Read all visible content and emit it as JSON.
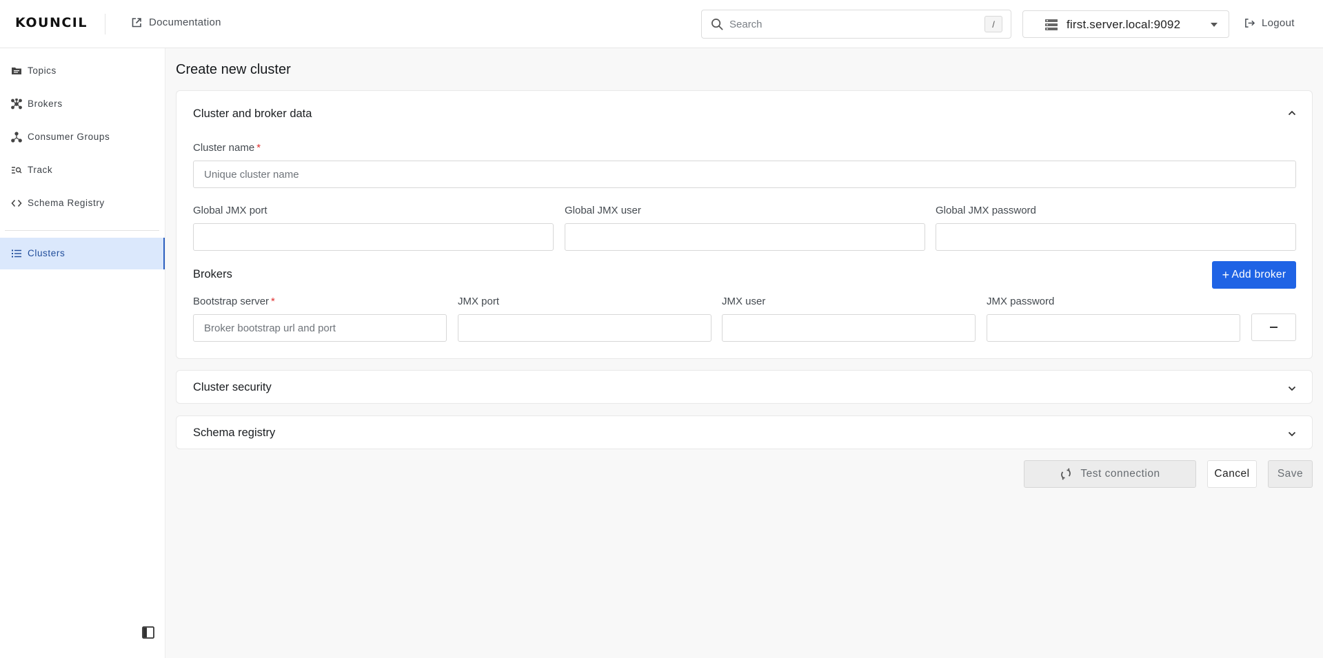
{
  "header": {
    "logo": "KOUNCIL",
    "documentation_label": "Documentation",
    "search_placeholder": "Search",
    "search_shortcut": "/",
    "server_selected": "first.server.local:9092",
    "logout_label": "Logout"
  },
  "sidebar": {
    "items": [
      {
        "label": "Topics",
        "icon": "folder-icon"
      },
      {
        "label": "Brokers",
        "icon": "brokers-network-icon"
      },
      {
        "label": "Consumer Groups",
        "icon": "consumer-groups-icon"
      },
      {
        "label": "Track",
        "icon": "track-search-icon"
      },
      {
        "label": "Schema Registry",
        "icon": "code-icon"
      },
      {
        "label": "Clusters",
        "icon": "list-icon",
        "active": true
      }
    ]
  },
  "main": {
    "page_title": "Create new cluster",
    "cluster_section": {
      "title": "Cluster and broker data",
      "cluster_name_label": "Cluster name",
      "required_mark": "*",
      "cluster_name_placeholder": "Unique cluster name",
      "global_jmx_port_label": "Global JMX port",
      "global_jmx_user_label": "Global JMX user",
      "global_jmx_password_label": "Global JMX password",
      "brokers_title": "Brokers",
      "add_broker_label": "Add broker",
      "add_broker_plus": "+",
      "bootstrap_server_label": "Bootstrap server",
      "bootstrap_server_placeholder": "Broker bootstrap url and port",
      "jmx_port_label": "JMX port",
      "jmx_user_label": "JMX user",
      "jmx_password_label": "JMX password"
    },
    "security_section_title": "Cluster security",
    "schema_section_title": "Schema registry",
    "buttons": {
      "test_connection": "Test connection",
      "cancel": "Cancel",
      "save": "Save"
    }
  },
  "colors": {
    "primary": "#1f63e5",
    "active_nav_bg": "#dbe8fc",
    "required": "#e03131"
  }
}
